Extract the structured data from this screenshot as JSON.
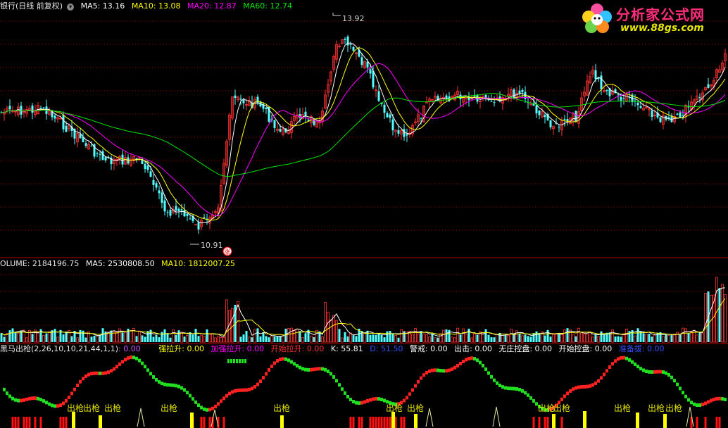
{
  "header": {
    "title": "银行(日线 前复权)",
    "ma5_label": "MA5: 13.16",
    "ma10_label": "MA10: 13.08",
    "ma20_label": "MA20: 12.87",
    "ma60_label": "MA60: 12.74"
  },
  "logo": {
    "name": "分析家公式网",
    "url": "www.88gs.com"
  },
  "price_annotations": {
    "high": "13.92",
    "low": "10.91",
    "marker": "涨"
  },
  "volume_header": {
    "volume": "OLUME: 2184196.75",
    "ma5": "MA5: 2530808.50",
    "ma10": "MA10: 1812007.25"
  },
  "indicator_header": {
    "name": "黑马出枪(2,26,10,10,21,44,1,1)",
    "value": ": 0.00",
    "qls": "强拉升: 0.00",
    "jqls": "加强拉升: 0.00",
    "ksls": "开始拉升: 0.00",
    "k": "K: 55.81",
    "d": "D: 51.50",
    "jj": "警戒: 0.00",
    "cj": "出击: 0.00",
    "wzkp": "无庄控盘: 0.00",
    "kskp": "开始控盘: 0.00",
    "zbs": "准备拔: 0.00"
  },
  "signal_label": "出枪",
  "colors": {
    "up": "#ff3232",
    "down": "#54ffff",
    "ma5": "#ffffff",
    "ma10": "#ffff00",
    "ma20": "#ff00ff",
    "ma60": "#00e600",
    "grid": "#a00000",
    "accent": "#e6e600"
  },
  "chart_data": [
    {
      "type": "candlestick",
      "title": "",
      "annotations": [
        {
          "label": "13.92",
          "value": 13.92
        },
        {
          "label": "10.91",
          "value": 10.91
        }
      ],
      "series": [
        {
          "name": "MA5",
          "value": 13.16
        },
        {
          "name": "MA10",
          "value": 13.08
        },
        {
          "name": "MA20",
          "value": 12.87
        },
        {
          "name": "MA60",
          "value": 12.74
        }
      ],
      "grid": true
    },
    {
      "type": "bar",
      "series": [
        {
          "name": "VOLUME",
          "value": 2184196.75
        },
        {
          "name": "MA5",
          "value": 2530808.5
        },
        {
          "name": "MA10",
          "value": 1812007.25
        }
      ],
      "grid": true
    },
    {
      "type": "line",
      "series": [
        {
          "name": "K",
          "value": 55.81
        },
        {
          "name": "D",
          "value": 51.5
        }
      ],
      "signal_text": "出枪"
    }
  ]
}
